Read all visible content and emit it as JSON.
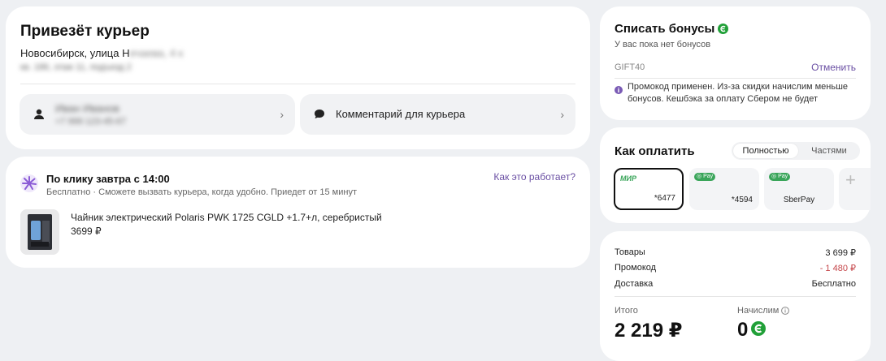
{
  "delivery": {
    "title": "Привезёт курьер",
    "address_visible": "Новосибирск, улица Н",
    "address_blurred": "ечаева, 4 к",
    "address_line2": "кв. 186, этаж 11, подъезд 2",
    "recipient_name": "Иван Иванов",
    "recipient_phone": "+7 999 123-45-67",
    "comment_label": "Комментарий для курьера"
  },
  "shipping": {
    "title": "По клику завтра с 14:00",
    "price_label": "Бесплатно",
    "separator": "·",
    "subtitle": "Сможете вызвать курьера, когда удобно. Приедет от 15 минут",
    "how_link": "Как это работает?",
    "product_name": "Чайник электрический Polaris PWK 1725 CGLD +1.7+л, серебристый",
    "product_price": "3699 ₽"
  },
  "bonus": {
    "title": "Списать бонусы",
    "subtitle": "У вас пока нет бонусов",
    "promo_code": "GIFT40",
    "cancel_label": "Отменить",
    "note": "Промокод применен. Из-за скидки начислим меньше бонусов. Кешбэка за оплату Сбером не будет"
  },
  "payment": {
    "title": "Как оплатить",
    "option_full": "Полностью",
    "option_parts": "Частями",
    "cards": [
      {
        "brand": "МИР",
        "number": "*6477",
        "selected": true
      },
      {
        "badge": "Pay",
        "number": "*4594"
      },
      {
        "badge": "Pay",
        "name": "SberPay"
      }
    ]
  },
  "summary": {
    "goods_label": "Товары",
    "goods_value": "3 699 ₽",
    "promo_label": "Промокод",
    "promo_value": "- 1 480 ₽",
    "delivery_label": "Доставка",
    "delivery_value": "Бесплатно",
    "total_label": "Итого",
    "total_value": "2 219 ₽",
    "accrue_label": "Начислим",
    "accrue_value": "0"
  },
  "colors": {
    "accent_purple": "#6a4fa3",
    "bonus_green": "#21a038",
    "discount_red": "#c5464a"
  }
}
